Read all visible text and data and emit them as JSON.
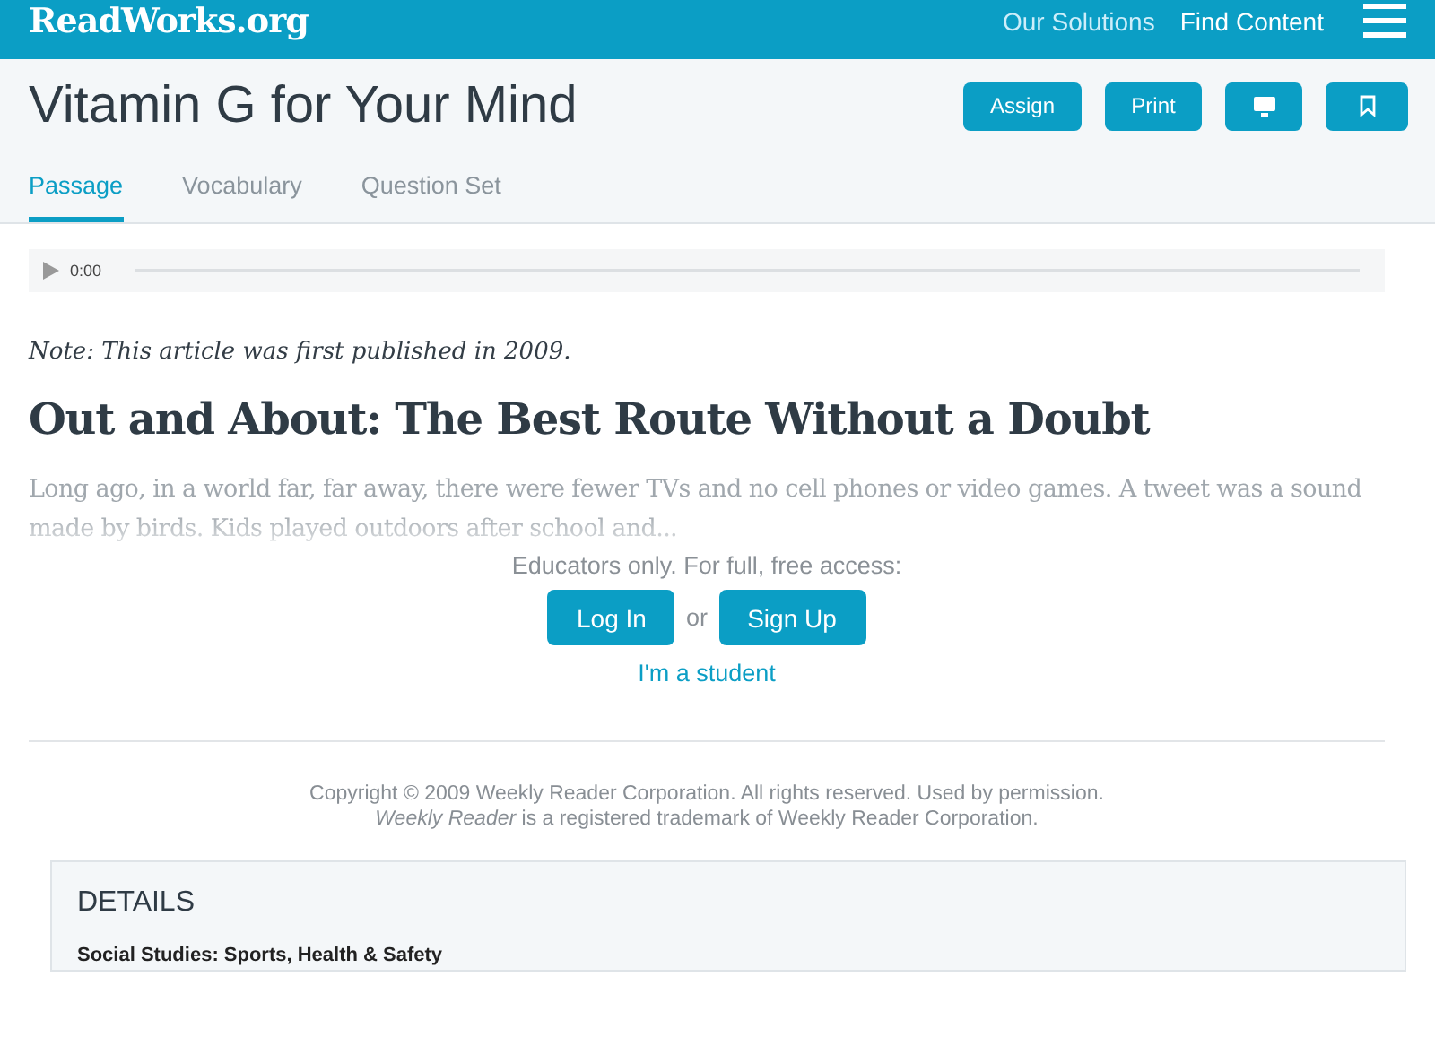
{
  "header": {
    "logo": "ReadWorks.org",
    "nav": [
      "Our Solutions",
      "Find Content"
    ]
  },
  "title": "Vitamin G for Your Mind",
  "actions": [
    {
      "kind": "text",
      "label": "Assign"
    },
    {
      "kind": "text",
      "label": "Print"
    },
    {
      "kind": "screen"
    },
    {
      "kind": "bookmark"
    }
  ],
  "tabs": [
    {
      "label": "Passage",
      "selected": true
    },
    {
      "label": "Vocabulary",
      "selected": false
    },
    {
      "label": "Question Set",
      "selected": false
    }
  ],
  "audio": {
    "time": "0:00"
  },
  "note": "Note: This article was first published in 2009.",
  "heading": "Out and About: The Best Route Without a Doubt",
  "excerpt": "Long ago, in a world far, far away, there were fewer TVs and no cell phones or video games. A tweet was a sound made by birds. Kids played outdoors after school and...",
  "access": {
    "prompt": "Educators only. For full, free access:",
    "login": "Log In",
    "or": "or",
    "signup": "Sign Up",
    "student": "I'm a student"
  },
  "copyright": [
    "Copyright © 2009 Weekly Reader Corporation. All rights reserved. Used by permission.",
    "*Weekly Reader* is a registered trademark of Weekly Reader Corporation."
  ],
  "details": {
    "title": "DETAILS",
    "subject": "Social Studies: Sports, Health & Safety"
  }
}
